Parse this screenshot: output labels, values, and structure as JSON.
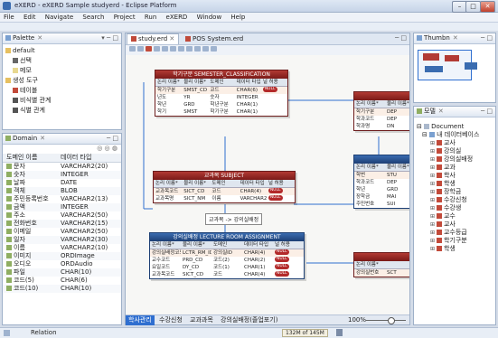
{
  "window": {
    "title": "eXERD - eXERD Sample studyerd - Eclipse Platform",
    "min": "–",
    "max": "□",
    "close": "✕"
  },
  "menu": [
    "File",
    "Edit",
    "Navigate",
    "Search",
    "Project",
    "Run",
    "eXERD",
    "Window",
    "Help"
  ],
  "palette": {
    "tab": "Palette",
    "items": [
      {
        "label": "default",
        "indent": 0,
        "icon": "folder-icon"
      },
      {
        "label": "선택",
        "indent": 1,
        "icon": "select-icon"
      },
      {
        "label": "메모",
        "indent": 1,
        "icon": "memo-icon"
      },
      {
        "label": "생성 도구",
        "indent": 0,
        "icon": "folder-icon"
      },
      {
        "label": "테이블",
        "indent": 1,
        "icon": "table-icon"
      },
      {
        "label": "비식별 관계",
        "indent": 1,
        "icon": "relation-icon"
      },
      {
        "label": "식별 관계",
        "indent": 1,
        "icon": "relation-icon"
      }
    ]
  },
  "domain": {
    "tab": "Domain",
    "headers": [
      "도메인 이름",
      "데이터 타입"
    ],
    "rows": [
      [
        "문자",
        "VARCHAR2(20)"
      ],
      [
        "숫자",
        "INTEGER"
      ],
      [
        "날짜",
        "DATE"
      ],
      [
        "객체",
        "BLOB"
      ],
      [
        "주민등록번호",
        "VARCHAR2(13)"
      ],
      [
        "금액",
        "INTEGER"
      ],
      [
        "주소",
        "VARCHAR2(50)"
      ],
      [
        "전화번호",
        "VARCHAR2(15)"
      ],
      [
        "이메일",
        "VARCHAR2(50)"
      ],
      [
        "일자",
        "VARCHAR2(30)"
      ],
      [
        "이름",
        "VARCHAR2(10)"
      ],
      [
        "이미지",
        "ORDImage"
      ],
      [
        "오디오",
        "ORDAudio"
      ],
      [
        "파일",
        "CHAR(10)"
      ],
      [
        "코드(5)",
        "CHAR(6)"
      ],
      [
        "코드(10)",
        "CHAR(10)"
      ]
    ]
  },
  "editor": {
    "tabs": [
      "study.erd",
      "POS System.erd"
    ],
    "entities": {
      "semester": {
        "title": "학기구분  SEMESTER_CLASSIFICATION",
        "cols": [
          "논리 이름*",
          "물리 이름*",
          "도메인",
          "데이터 타입",
          "널 허용"
        ],
        "rows": [
          [
            "학기구분",
            "SMST_CD",
            "코드",
            "CHAR(6)",
            "NULL"
          ],
          [
            "년도",
            "YR",
            "숫자",
            "INTEGER",
            ""
          ],
          [
            "학년",
            "GRD",
            "학년구분",
            "CHAR(1)",
            ""
          ],
          [
            "학기",
            "SMST",
            "학기구분",
            "CHAR(1)",
            ""
          ]
        ]
      },
      "subject": {
        "title": "교과목  SUBJECT",
        "cols": [
          "논리 이름*",
          "물리 이름*",
          "도메인",
          "데이터 타입",
          "널 허용"
        ],
        "rows": [
          [
            "교과목코드",
            "SICT_CD",
            "코드",
            "CHAR(4)",
            "NULL"
          ],
          [
            "교과목명",
            "SICT_NM",
            "이름",
            "VARCHAR2(40)",
            "NULL"
          ]
        ]
      },
      "lecture": {
        "title": "강의실배정  LECTURE ROOM ASSIGNMENT",
        "cols": [
          "논리 이름*",
          "물리 이름*",
          "도메인",
          "데이터 타입",
          "널 허용"
        ],
        "rows": [
          [
            "강의실배정코드",
            "LCTR_RM_ID",
            "강의실ID",
            "CHAR(4)",
            "NULL"
          ],
          [
            "교수코드",
            "PRD_CD",
            "코드(2)",
            "CHAR(2)",
            "NULL"
          ],
          [
            "요일코드",
            "DY_CD",
            "코드(1)",
            "CHAR(1)",
            "NULL"
          ],
          [
            "교과목코드",
            "SICT_CD",
            "코드",
            "CHAR(4)",
            "NULL"
          ]
        ]
      },
      "right1": {
        "title": "",
        "cols": [
          "논리 이름*",
          "물리 이름*"
        ],
        "rows": [
          [
            "학기구분",
            "DEP"
          ],
          [
            "학과코드",
            "DEP"
          ],
          [
            "학과명",
            "DN"
          ]
        ]
      },
      "right2": {
        "title": "",
        "cols": [
          "논리 이름*",
          "물리 이름*"
        ],
        "rows": [
          [
            "학번",
            "STU"
          ],
          [
            "학과코드",
            "DEP"
          ],
          [
            "학년",
            "GRD"
          ],
          [
            "장학금",
            "MAI"
          ],
          [
            "주민번호",
            "SUI"
          ]
        ]
      },
      "right3": {
        "title": "",
        "cols": [
          "논리 이름*"
        ],
        "rows": [
          [
            "강의실번호",
            "SCT"
          ]
        ]
      }
    },
    "relation_label": "교과목 -> 강의실배정",
    "bottom_tabs": [
      "학사관리",
      "수강신청",
      "교과과목",
      "강의실배정(졸업포기)"
    ],
    "zoom": "100%"
  },
  "thumbnail": {
    "tab": "Thumbn"
  },
  "model": {
    "tab": "모델",
    "root": "Document",
    "diagram": "내 데이터베이스",
    "items": [
      "교사",
      "강의실",
      "강의실배정",
      "교과",
      "학사",
      "학생",
      "장학금",
      "수강신청",
      "수강생",
      "교수",
      "교사",
      "교수등급",
      "학기구분",
      "학생"
    ]
  },
  "status": {
    "left": "Relation",
    "memory": "132M of 145M"
  },
  "colors": {
    "entity_red": "#7a1a18",
    "entity_blue": "#1d3f74",
    "selection": "#2f6fd0"
  }
}
